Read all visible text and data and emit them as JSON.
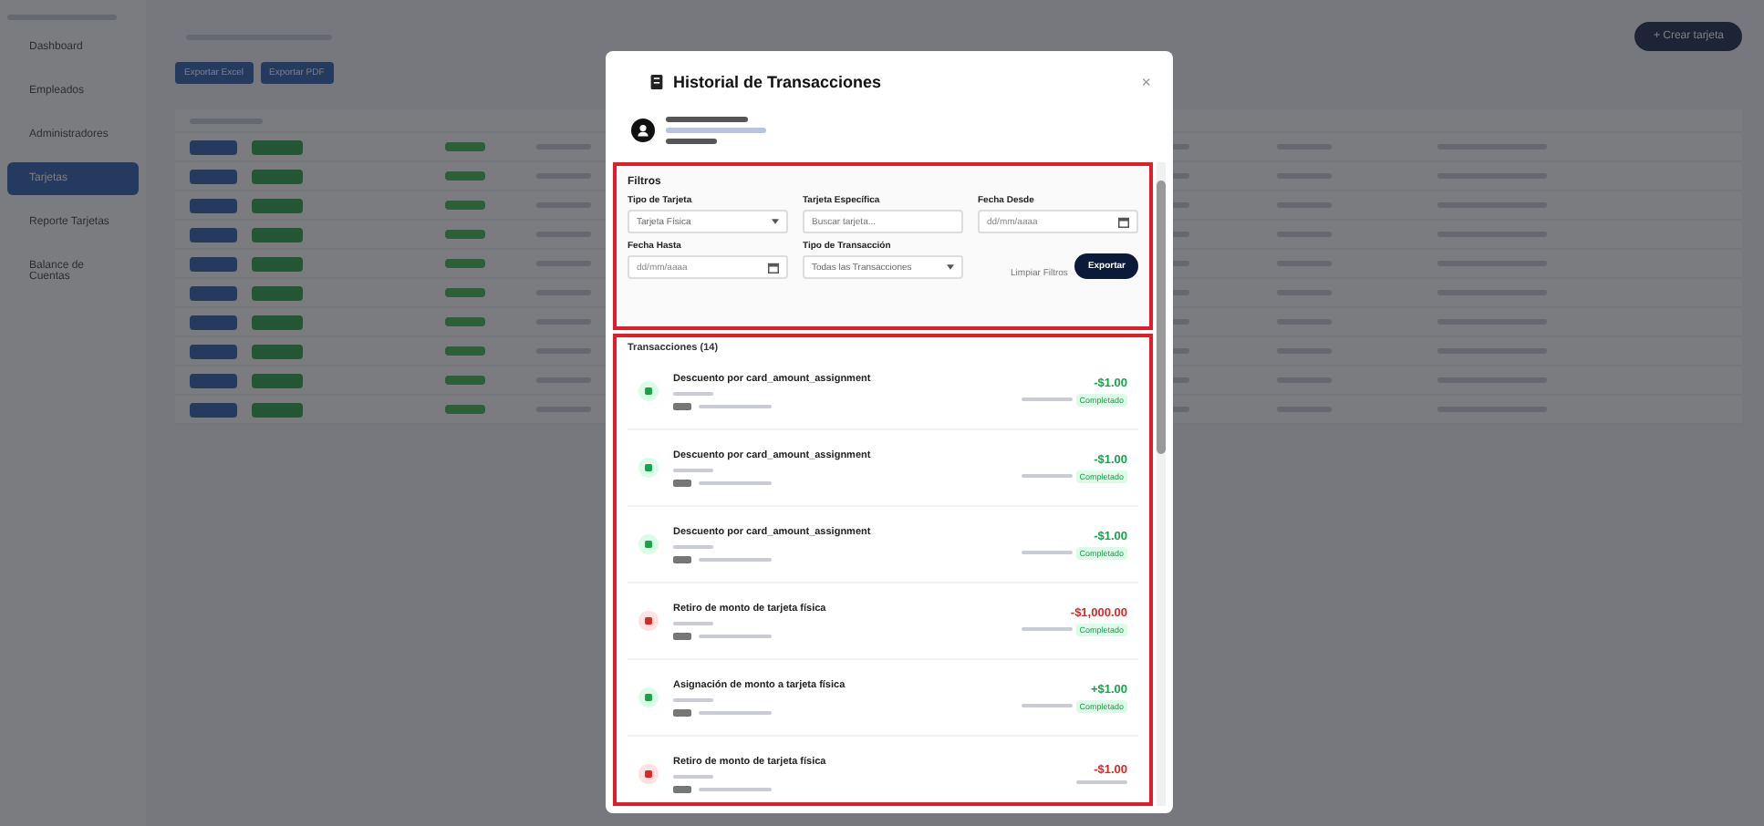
{
  "sidebar": {
    "items": [
      {
        "label": "Dashboard",
        "selected": false
      },
      {
        "label": "Empleados",
        "selected": false
      },
      {
        "label": "Administradores",
        "selected": false
      },
      {
        "label": "Tarjetas",
        "selected": true
      },
      {
        "label": "Reporte Tarjetas",
        "selected": false
      },
      {
        "label": "Balance de Cuentas",
        "selected": false
      }
    ]
  },
  "toolbar": {
    "buttons": [
      "Exportar Excel",
      "Exportar PDF"
    ],
    "create_button": "+ Crear tarjeta"
  },
  "modal": {
    "title": "Historial de Transacciones",
    "close": "×",
    "filters": {
      "title": "Filtros",
      "card_type": {
        "label": "Tipo de Tarjeta",
        "value": "Tarjeta Física"
      },
      "card": {
        "label": "Tarjeta Específica",
        "placeholder": "Buscar tarjeta..."
      },
      "date_from": {
        "label": "Fecha Desde",
        "placeholder": "dd/mm/aaaa"
      },
      "date_to": {
        "label": "Fecha Hasta",
        "placeholder": "dd/mm/aaaa"
      },
      "tx_type": {
        "label": "Tipo de Transacción",
        "value": "Todas las Transacciones"
      },
      "clear": "Limpiar Filtros",
      "export": "Exportar"
    },
    "transactions_title": "Transacciones (14)",
    "transactions": [
      {
        "kind": "credit",
        "title": "Descuento por card_amount_assignment",
        "amount": "-$1.00",
        "status": "Completado"
      },
      {
        "kind": "credit",
        "title": "Descuento por card_amount_assignment",
        "amount": "-$1.00",
        "status": "Completado"
      },
      {
        "kind": "credit",
        "title": "Descuento por card_amount_assignment",
        "amount": "-$1.00",
        "status": "Completado"
      },
      {
        "kind": "debit",
        "title": "Retiro de monto de tarjeta física",
        "amount": "-$1,000.00",
        "status": "Completado"
      },
      {
        "kind": "credit",
        "title": "Asignación de monto a tarjeta física",
        "amount": "+$1.00",
        "status": "Completado"
      },
      {
        "kind": "debit",
        "title": "Retiro de monto de tarjeta física",
        "amount": "-$1.00"
      }
    ]
  }
}
